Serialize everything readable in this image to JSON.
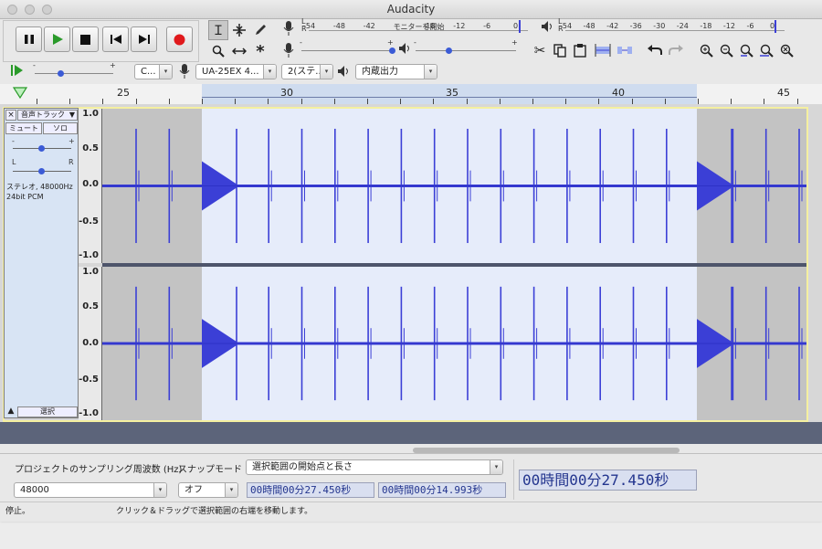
{
  "window": {
    "title": "Audacity"
  },
  "transport": {
    "buttons": [
      "pause",
      "play",
      "stop",
      "skip-start",
      "skip-end",
      "record"
    ]
  },
  "meters": {
    "record_ticks": [
      "-54",
      "-48",
      "-42",
      "モニターを開始",
      "-18",
      "-12",
      "-6",
      "0"
    ],
    "play_ticks": [
      "-54",
      "-48",
      "-42",
      "-36",
      "-30",
      "-24",
      "-18",
      "-12",
      "-6",
      "0"
    ],
    "lr_labels": [
      "L",
      "R"
    ]
  },
  "device_toolbar": {
    "host": "C...",
    "input_device": "UA-25EX 4...",
    "channels": "2(ステ...",
    "output_device": "内蔵出力"
  },
  "timeline": {
    "ticks": [
      "25",
      "30",
      "35",
      "40",
      "45"
    ]
  },
  "track": {
    "name": "音声トラック",
    "mute_label": "ミュート",
    "solo_label": "ソロ",
    "gain_minus": "-",
    "gain_plus": "+",
    "pan_left": "L",
    "pan_right": "R",
    "info_line1": "ステレオ, 48000Hz",
    "info_line2": "24bit PCM",
    "select_label": "選択",
    "scale_labels": [
      "1.0",
      "0.5",
      "0.0",
      "-0.5",
      "-1.0"
    ]
  },
  "selection_toolbar": {
    "rate_label": "プロジェクトのサンプリング周波数 (Hz)",
    "rate_value": "48000",
    "snap_label": "スナップモード",
    "snap_value": "オフ",
    "range_mode": "選択範囲の開始点と長さ",
    "start_time": "00時間00分27.450秒",
    "length_time": "00時間00分14.993秒",
    "audio_position": "00時間00分27.450秒"
  },
  "status": {
    "state": "停止。",
    "hint": "クリック＆ドラッグで選択範囲の右端を移動します。"
  },
  "colors": {
    "waveform": "#3b3fd6",
    "selection_bg": "#e6ecfa",
    "unselected_bg": "#c3c3c3",
    "track_panel": "#d8e4f4",
    "record_red": "#e0191c",
    "play_green": "#2a9a2a"
  }
}
